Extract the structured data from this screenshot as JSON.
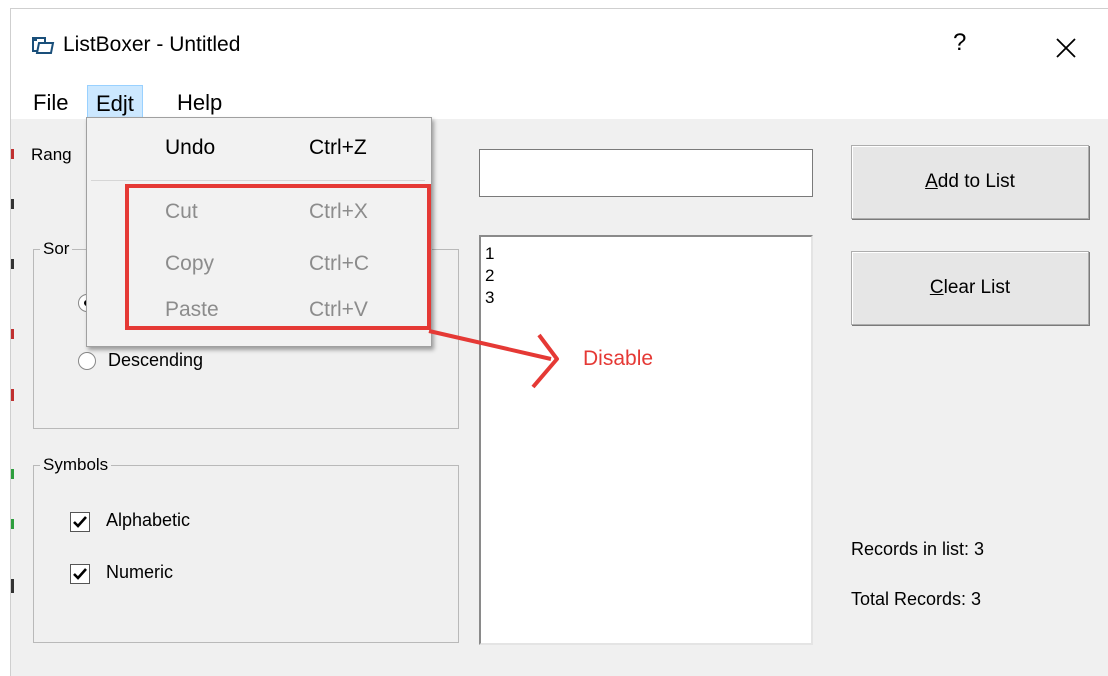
{
  "window": {
    "title": "ListBoxer - Untitled",
    "help_label": "?",
    "close_label": "✕"
  },
  "menu": {
    "file": "File",
    "edit": "Edjt",
    "help": "Help"
  },
  "edit_menu": {
    "items": [
      {
        "label": "Undo",
        "shortcut": "Ctrl+Z",
        "enabled": true
      },
      {
        "label": "Cut",
        "shortcut": "Ctrl+X",
        "enabled": false
      },
      {
        "label": "Copy",
        "shortcut": "Ctrl+C",
        "enabled": false
      },
      {
        "label": "Paste",
        "shortcut": "Ctrl+V",
        "enabled": false
      }
    ]
  },
  "range_label": "Rang",
  "sort_group": {
    "legend": "Sor",
    "descending_label": "Descending",
    "ascending_selected": true
  },
  "symbols_group": {
    "legend": "Symbols",
    "alphabetic_label": "Alphabetic",
    "alphabetic_checked": true,
    "numeric_label": "Numeric",
    "numeric_checked": true
  },
  "input_value": "",
  "list_items": [
    "1",
    "2",
    "3"
  ],
  "buttons": {
    "add_prefix": "A",
    "add_rest": "dd to List",
    "clear_prefix": "C",
    "clear_rest": "lear List"
  },
  "status": {
    "records_in_list": "Records in list: 3",
    "total_records": "Total Records: 3"
  },
  "annotation": {
    "text": "Disable",
    "color": "#e53935"
  },
  "colors": {
    "menu_highlight": "#cce8ff",
    "disabled_text": "#8c8c8c",
    "window_bg": "#f0f0f0"
  }
}
